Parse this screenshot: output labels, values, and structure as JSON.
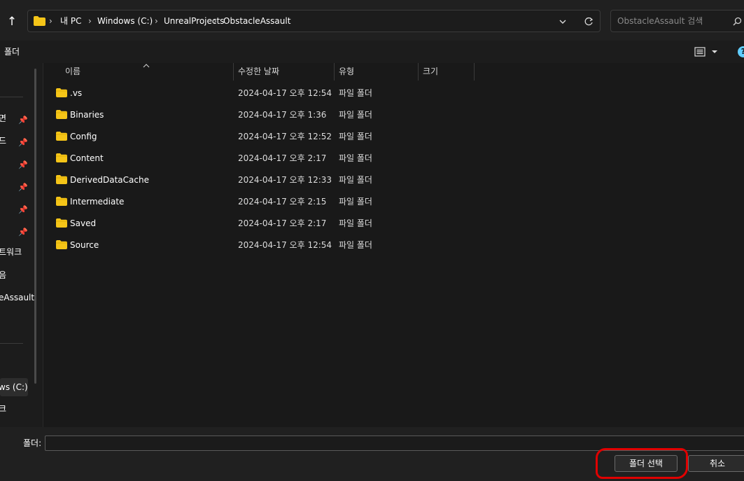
{
  "nav": {
    "breadcrumbs": [
      "내 PC",
      "Windows (C:)",
      "UnrealProjects",
      "ObstacleAssault"
    ],
    "search": {
      "placeholder": "ObstacleAssault 검색"
    }
  },
  "command_bar": {
    "new_folder_label": "폴더"
  },
  "sidebar": {
    "items": [
      {
        "label": "면",
        "pinned": true
      },
      {
        "label": "드",
        "pinned": true
      },
      {
        "label": "",
        "pinned": true
      },
      {
        "label": "",
        "pinned": true
      },
      {
        "label": "",
        "pinned": true
      },
      {
        "label": "",
        "pinned": true
      },
      {
        "label": "트워크",
        "pinned": false
      },
      {
        "label": "음",
        "pinned": false
      },
      {
        "label": "eAssault",
        "pinned": false
      }
    ],
    "drives": [
      {
        "label": "ws (C:)",
        "selected": true
      },
      {
        "label": "크",
        "selected": false
      }
    ]
  },
  "columns": [
    "이름",
    "수정한 날짜",
    "유형",
    "크기"
  ],
  "files": [
    {
      "name": ".vs",
      "date": "2024-04-17 오후 12:54",
      "type": "파일 폴더"
    },
    {
      "name": "Binaries",
      "date": "2024-04-17 오후 1:36",
      "type": "파일 폴더"
    },
    {
      "name": "Config",
      "date": "2024-04-17 오후 12:52",
      "type": "파일 폴더"
    },
    {
      "name": "Content",
      "date": "2024-04-17 오후 2:17",
      "type": "파일 폴더"
    },
    {
      "name": "DerivedDataCache",
      "date": "2024-04-17 오후 12:33",
      "type": "파일 폴더"
    },
    {
      "name": "Intermediate",
      "date": "2024-04-17 오후 2:15",
      "type": "파일 폴더"
    },
    {
      "name": "Saved",
      "date": "2024-04-17 오후 2:17",
      "type": "파일 폴더"
    },
    {
      "name": "Source",
      "date": "2024-04-17 오후 12:54",
      "type": "파일 폴더"
    }
  ],
  "footer": {
    "folder_label": "폴더:",
    "folder_value": "",
    "select_button": "폴더 선택",
    "cancel_button": "취소"
  },
  "colors": {
    "folder": "#f5c518",
    "highlight": "#e00000",
    "accent": "#60cdff"
  }
}
